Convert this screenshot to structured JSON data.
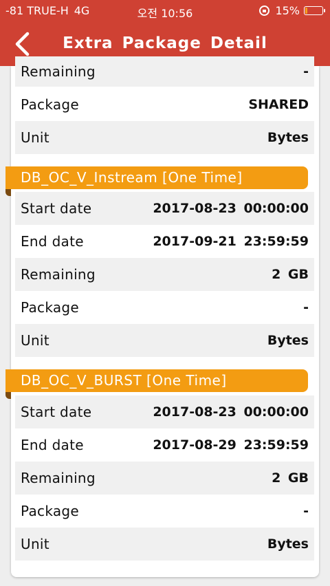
{
  "status_bar": {
    "carrier": "-81 TRUE-H",
    "network": "4G",
    "time": "오전 10:56",
    "battery": "15%",
    "battery_level": 0.15
  },
  "header": {
    "title": "Extra Package Detail"
  },
  "top_rows": [
    {
      "label": "Remaining",
      "value": "-"
    },
    {
      "label": "Package",
      "value": "SHARED"
    },
    {
      "label": "Unit",
      "value": "Bytes"
    }
  ],
  "packages": [
    {
      "name": "DB_OC_V_Instream [One Time]",
      "rows": [
        {
          "label": "Start date",
          "value": "2017-08-23 00:00:00"
        },
        {
          "label": "End date",
          "value": "2017-09-21 23:59:59"
        },
        {
          "label": "Remaining",
          "value": "2 GB"
        },
        {
          "label": "Package",
          "value": "-"
        },
        {
          "label": "Unit",
          "value": "Bytes"
        }
      ]
    },
    {
      "name": "DB_OC_V_BURST [One Time]",
      "rows": [
        {
          "label": "Start date",
          "value": "2017-08-23 00:00:00"
        },
        {
          "label": "End date",
          "value": "2017-08-29 23:59:59"
        },
        {
          "label": "Remaining",
          "value": "2 GB"
        },
        {
          "label": "Package",
          "value": "-"
        },
        {
          "label": "Unit",
          "value": "Bytes"
        }
      ]
    }
  ]
}
